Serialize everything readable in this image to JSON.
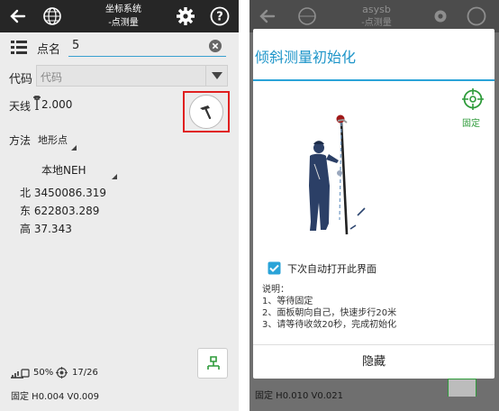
{
  "left": {
    "header": {
      "title_line1": "坐标系统",
      "title_line2": "-点测量"
    },
    "point_name": {
      "label": "点名",
      "value": "5"
    },
    "code": {
      "label": "代码",
      "placeholder": "代码"
    },
    "antenna": {
      "label": "天线",
      "value": "2.000"
    },
    "method": {
      "label": "方法",
      "value": "地形点"
    },
    "coord_system": {
      "value": "本地NEH"
    },
    "coords": [
      {
        "label": "北",
        "value": "3450086.319"
      },
      {
        "label": "东",
        "value": "622803.289"
      },
      {
        "label": "高",
        "value": "37.343"
      }
    ],
    "status": {
      "battery": "50%",
      "satellites": "17/26",
      "fix": "固定 H0.004 V0.009"
    }
  },
  "right": {
    "header": {
      "title_line1": "asysb",
      "title_line2": "-点测量"
    },
    "dialog": {
      "title": "倾斜测量初始化",
      "fixed_label": "固定",
      "checkbox_label": "下次自动打开此界面",
      "checkbox_checked": true,
      "notes": [
        "说明：",
        "1、等待固定",
        "2、面板朝向自己，快速步行20米",
        "3、请等待收敛20秒，完成初始化"
      ],
      "hide_button": "隐藏"
    },
    "status": {
      "fix": "固定 H0.010 V0.021"
    }
  },
  "colors": {
    "accent": "#1e95c9",
    "fixed_green": "#2e9b3a",
    "highlight_red": "#e02020"
  }
}
